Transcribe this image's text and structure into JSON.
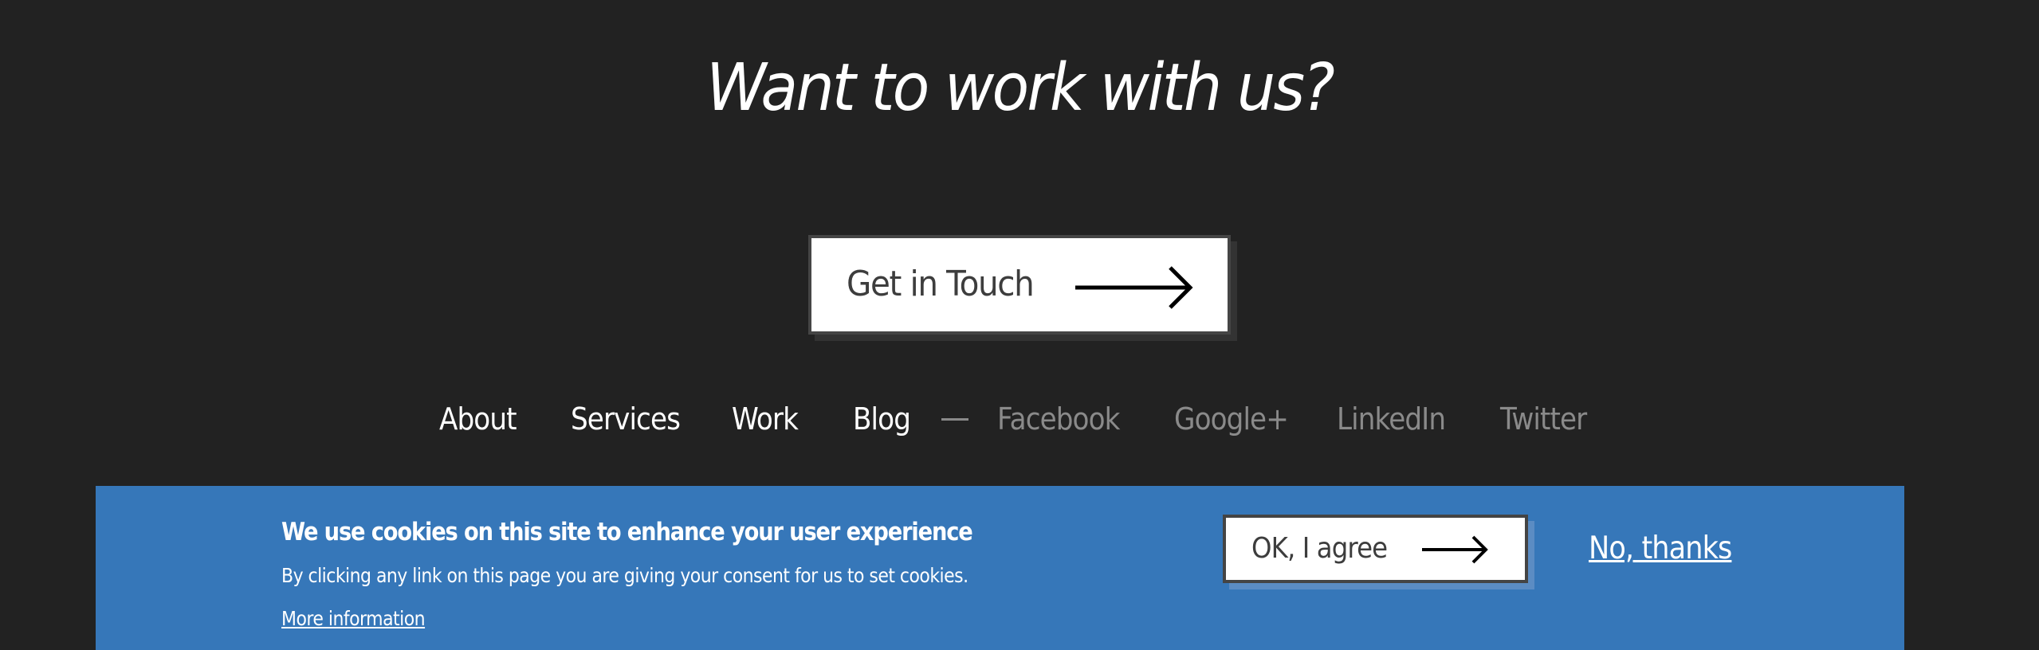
{
  "cta": {
    "title": "Want to work with us?",
    "button_label": "Get in Touch",
    "button_icon": "arrow-right-icon"
  },
  "nav": {
    "primary": [
      {
        "label": "About"
      },
      {
        "label": "Services"
      },
      {
        "label": "Work"
      },
      {
        "label": "Blog"
      }
    ],
    "separator": "—",
    "social": [
      {
        "label": "Facebook"
      },
      {
        "label": "Google+"
      },
      {
        "label": "LinkedIn"
      },
      {
        "label": "Twitter"
      }
    ]
  },
  "cookie_banner": {
    "heading": "We use cookies on this site to enhance your user experience",
    "text": "By clicking any link on this page you are giving your consent for us to set cookies.",
    "more_info_label": "More information",
    "agree_label": "OK, I agree",
    "agree_icon": "arrow-right-icon",
    "decline_label": "No, thanks"
  },
  "colors": {
    "page_background": "#222222",
    "banner_background": "#3677b9",
    "primary_nav_text": "#ffffff",
    "social_nav_text": "#8a8a8a",
    "button_text": "#3d3d3d"
  }
}
